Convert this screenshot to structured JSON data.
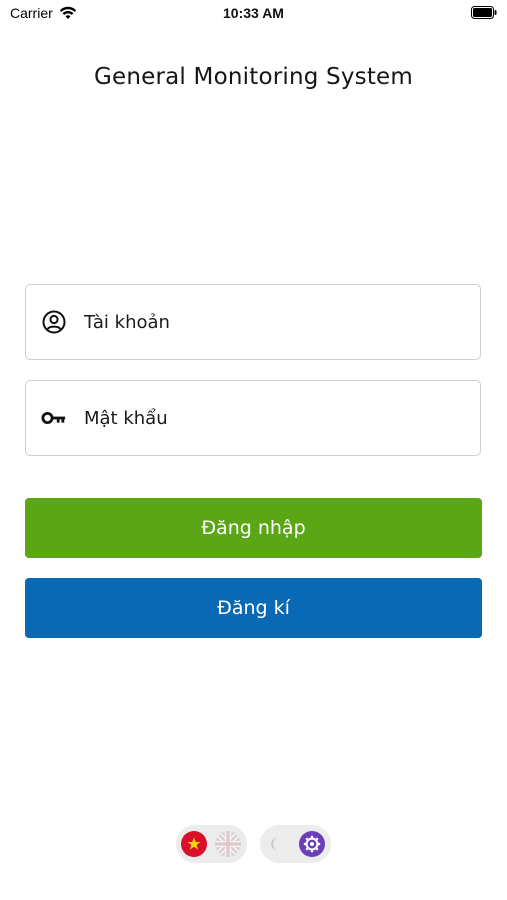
{
  "status_bar": {
    "carrier": "Carrier",
    "time": "10:33 AM"
  },
  "header": {
    "title": "General Monitoring System"
  },
  "form": {
    "account_placeholder": "Tài khoản",
    "password_placeholder": "Mật khẩu"
  },
  "buttons": {
    "login_label": "Đăng nhập",
    "register_label": "Đăng kí"
  },
  "colors": {
    "login_button": "#5aa614",
    "register_button": "#0a69b5",
    "theme_accent": "#6b3fb8"
  },
  "footer": {
    "language_options": [
      "vietnam-flag-icon",
      "uk-flag-icon"
    ],
    "language_selected": "vietnam-flag-icon",
    "theme_options": [
      "moon-icon",
      "gear-icon"
    ],
    "theme_selected": "gear-icon"
  }
}
